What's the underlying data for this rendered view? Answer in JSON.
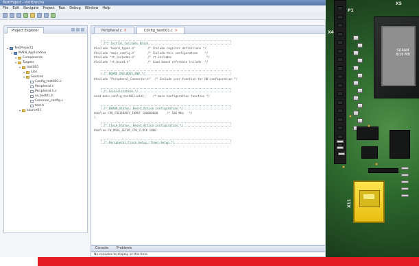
{
  "window": {
    "title": "TestProject - ind 6/src/ss",
    "menu": [
      "File",
      "Edit",
      "Navigate",
      "Project",
      "Run",
      "Debug",
      "Window",
      "Help"
    ]
  },
  "toolbar": {
    "icons": [
      "new-icon",
      "save-icon",
      "print-icon",
      "run-icon",
      "debug-icon",
      "settings-icon",
      "build-icon",
      "refresh-icon"
    ]
  },
  "project_explorer": {
    "tab_label": "Project Explorer",
    "tree": [
      {
        "label": "TestProject1",
        "level": 0
      },
      {
        "label": "MAIN_Application",
        "level": 1
      },
      {
        "label": "Components",
        "level": 2
      },
      {
        "label": "Targets",
        "level": 2
      },
      {
        "label": "test001",
        "level": 3
      },
      {
        "label": "Libs",
        "level": 4
      },
      {
        "label": "Sources",
        "level": 4
      },
      {
        "label": "Config_test001.c",
        "level": 5
      },
      {
        "label": "Peripheral.c",
        "level": 5
      },
      {
        "label": "Peripheral.h.c",
        "level": 5
      },
      {
        "label": "os_test01.h",
        "level": 5
      },
      {
        "label": "Common_config.c",
        "level": 5
      },
      {
        "label": "test.h",
        "level": 5
      },
      {
        "label": "source01",
        "level": 3
      }
    ]
  },
  "editor": {
    "tabs": [
      {
        "label": "Peripheral.c",
        "active": false
      },
      {
        "label": "Config_test001.c",
        "active": true
      }
    ],
    "code": [
      {
        "text": "/** Initial Includes Block",
        "kind": "comment"
      },
      {
        "text": "#include \"board_types.h\"       /* Include register definitions */",
        "kind": "code"
      },
      {
        "text": "#include \"main_config.h\"       /* Include this configuration    */",
        "kind": "code"
      },
      {
        "text": "#include \"rt_includes.h\"       /* rt includes                    */",
        "kind": "code"
      },
      {
        "text": "#include \"rt_board.h\"          /* Load board reference include  */",
        "kind": "code"
      },
      {
        "text": "",
        "kind": "blank"
      },
      {
        "text": "/* BOARD INCLUDES END */",
        "kind": "comment"
      },
      {
        "text": "#include \"Peripheral_Connector.h\"  /* Include user function for HW configuration */",
        "kind": "code"
      },
      {
        "text": "",
        "kind": "blank"
      },
      {
        "text": "/* Initialization */",
        "kind": "comment"
      },
      {
        "text": "void main_config_test01(void);    /* main configuration function */",
        "kind": "code"
      },
      {
        "text": "",
        "kind": "blank"
      },
      {
        "text": "/* ERROR_Status, Reset_Action configuration */",
        "kind": "comment"
      },
      {
        "text": "#define CPU_FREQUENCY_INPUT 100000000     /* 100 MHz   */",
        "kind": "code"
      },
      {
        "text": "}",
        "kind": "code"
      },
      {
        "text": "/* Clock Status, Reset_Action configuration */",
        "kind": "comment"
      },
      {
        "text": "#define FW_PROG_SETUP_CPU_CLOCK 1000",
        "kind": "code"
      },
      {
        "text": "",
        "kind": "blank"
      },
      {
        "text": "/* Peripheral Clock Setup, Timer Setup */",
        "kind": "comment"
      }
    ]
  },
  "console": {
    "tabs": [
      "Console",
      "Problems"
    ],
    "message": "No consoles to display at this time."
  },
  "board": {
    "labels": [
      "P1",
      "X4",
      "X5",
      "X11",
      "SDRAM",
      "8/16 MB"
    ],
    "sdram": {
      "line1": "SDRAM",
      "line2": "8/16 MB"
    }
  },
  "colors": {
    "accent_bar": "#e31c23",
    "board_green": "#2d6a2d",
    "usb_yellow": "#ffe44b"
  }
}
